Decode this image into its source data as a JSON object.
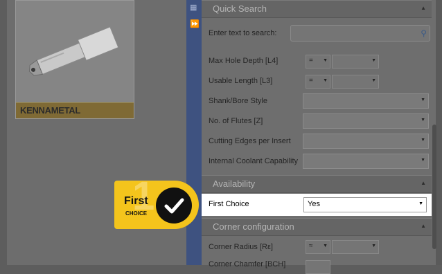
{
  "product": {
    "brand": "KENNAMETAL"
  },
  "quick_search": {
    "title": "Quick Search",
    "search_label": "Enter text to search:",
    "search_placeholder": ""
  },
  "filters": [
    {
      "label": "Max Hole Depth [L4]",
      "operator": "=",
      "value": ""
    },
    {
      "label": "Usable Length [L3]",
      "operator": "=",
      "value": ""
    },
    {
      "label": "Shank/Bore Style",
      "value": ""
    },
    {
      "label": "No. of Flutes [Z]",
      "value": ""
    },
    {
      "label": "Cutting Edges per Insert",
      "value": ""
    },
    {
      "label": "Internal Coolant Capability",
      "value": ""
    }
  ],
  "availability": {
    "title": "Availability",
    "first_choice_label": "First Choice",
    "first_choice_value": "Yes"
  },
  "corner_configuration": {
    "title": "Corner configuration",
    "corner_radius_label": "Corner Radius [Rε]",
    "corner_radius_operator": "≈",
    "partial_row_label": "Corner Chamfer [BCH]"
  },
  "badge": {
    "big_digit": "1",
    "line1": "First",
    "line2": "CHOICE"
  },
  "colors": {
    "badge_yellow": "#f4c41c",
    "strip_blue": "#3e5280",
    "highlight": "#ffffff"
  },
  "icons": {
    "collapse": "double-chevron-right-icon",
    "search": "search-icon",
    "check": "checkmark-icon"
  }
}
